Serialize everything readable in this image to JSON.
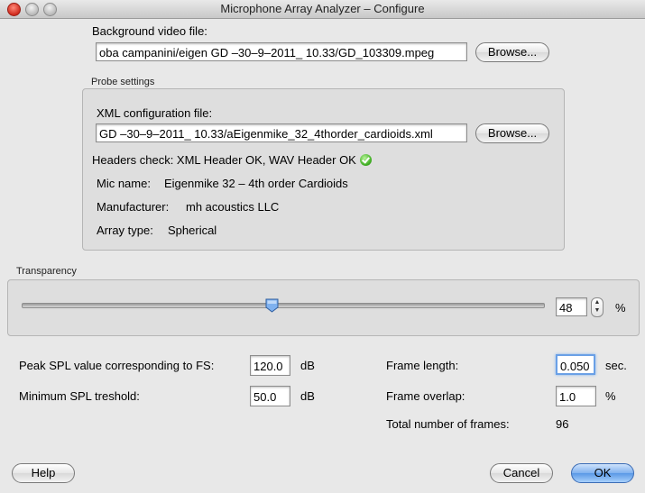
{
  "window": {
    "title": "Microphone Array Analyzer – Configure"
  },
  "background": {
    "label": "Background video file:",
    "path": "oba campanini/eigen GD –30–9–2011_ 10.33/GD_103309.mpeg",
    "browse": "Browse..."
  },
  "probe": {
    "group_label": "Probe settings",
    "xml_label": "XML configuration file:",
    "xml_path": "GD –30–9–2011_ 10.33/aEigenmike_32_4thorder_cardioids.xml",
    "browse": "Browse...",
    "headers_check": "Headers check: XML Header OK, WAV Header OK",
    "mic_name_label": "Mic name:",
    "mic_name": "Eigenmike 32 – 4th order Cardioids",
    "manufacturer_label": "Manufacturer:",
    "manufacturer": "mh acoustics LLC",
    "array_type_label": "Array type:",
    "array_type": "Spherical"
  },
  "transparency": {
    "group_label": "Transparency",
    "value": "48",
    "unit": "%",
    "level": 0.48
  },
  "spl": {
    "peak_label": "Peak SPL value corresponding to FS:",
    "peak_value": "120.0",
    "peak_unit": "dB",
    "min_label": "Minimum SPL treshold:",
    "min_value": "50.0",
    "min_unit": "dB"
  },
  "frames": {
    "length_label": "Frame length:",
    "length_value": "0.050",
    "length_unit": "sec.",
    "overlap_label": "Frame overlap:",
    "overlap_value": "1.0",
    "overlap_unit": "%",
    "total_label": "Total number of frames:",
    "total_value": "96"
  },
  "buttons": {
    "help": "Help",
    "cancel": "Cancel",
    "ok": "OK"
  },
  "colors": {
    "accent": "#5a98e6",
    "ok_green": "#3fae22"
  }
}
